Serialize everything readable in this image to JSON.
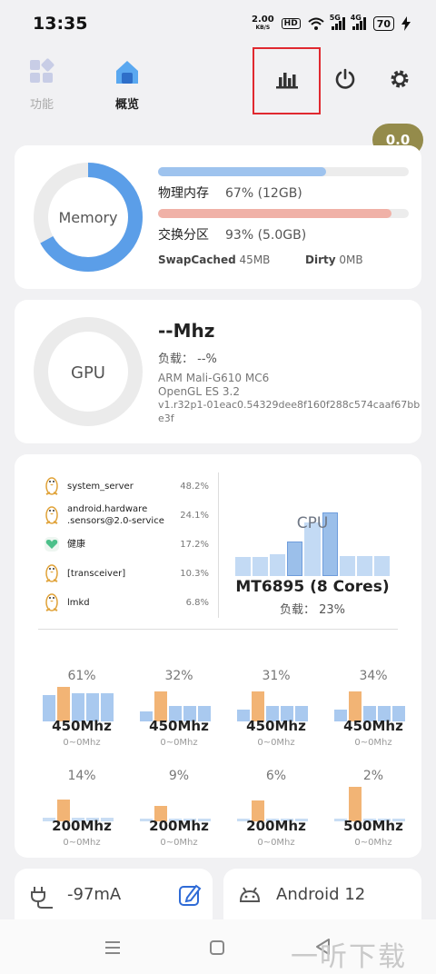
{
  "status": {
    "time": "13:35",
    "speed": "2.00",
    "speed_unit": "KB/S",
    "hd": "HD",
    "sig1": "5G",
    "sig2": "4G",
    "battery": "70"
  },
  "nav": {
    "features": "功能",
    "overview": "概览"
  },
  "badge": "0.0",
  "memory": {
    "ring_label": "Memory",
    "physical_label": "物理内存",
    "physical_value": "67% (12GB)",
    "physical_pct": 67,
    "swap_label": "交换分区",
    "swap_value": "93% (5.0GB)",
    "swap_pct": 93,
    "swapcached_label": "SwapCached",
    "swapcached_value": "45MB",
    "dirty_label": "Dirty",
    "dirty_value": "0MB",
    "colors": {
      "ring": "#5b9ee8",
      "physical": "#9ec3ee",
      "swap": "#f0b1a7"
    }
  },
  "gpu": {
    "ring_label": "GPU",
    "freq": "--Mhz",
    "load": "负载： --%",
    "model": "ARM Mali-G610 MC6",
    "api": "OpenGL ES 3.2",
    "driver_1": "v1.r32p1-01eac0.54329dee8f160f288c574caaf67bb",
    "driver_2": "e3f"
  },
  "processes": [
    {
      "name": "system_server",
      "value": "48.2%",
      "icon": "linux-penguin-icon"
    },
    {
      "name": "android.hardware",
      "name2": ".sensors@2.0-service",
      "value": "24.1%",
      "icon": "linux-penguin-icon"
    },
    {
      "name": "健康",
      "value": "17.2%",
      "icon": "health-heart-icon"
    },
    {
      "name": "[transceiver]",
      "value": "10.3%",
      "icon": "linux-penguin-icon"
    },
    {
      "name": "lmkd",
      "value": "6.8%",
      "icon": "linux-penguin-icon"
    }
  ],
  "cpu": {
    "label": "CPU",
    "model": "MT6895 (8 Cores)",
    "load": "负载： 23%",
    "overview_levels": [
      0.28,
      0.28,
      0.32,
      0.52,
      0.8,
      0.95,
      0.3,
      0.3,
      0.3
    ]
  },
  "cores": [
    {
      "pct": "61%",
      "freq": "450Mhz",
      "range": "0~0Mhz",
      "levels": [
        0.72,
        0.95,
        0.78,
        0.78,
        0.78
      ],
      "hi": 1
    },
    {
      "pct": "32%",
      "freq": "450Mhz",
      "range": "0~0Mhz",
      "levels": [
        0.28,
        0.82,
        0.42,
        0.42,
        0.42
      ],
      "hi": 1
    },
    {
      "pct": "31%",
      "freq": "450Mhz",
      "range": "0~0Mhz",
      "levels": [
        0.33,
        0.82,
        0.42,
        0.42,
        0.42
      ],
      "hi": 1
    },
    {
      "pct": "34%",
      "freq": "450Mhz",
      "range": "0~0Mhz",
      "levels": [
        0.33,
        0.82,
        0.42,
        0.42,
        0.42
      ],
      "hi": 1
    },
    {
      "pct": "14%",
      "freq": "200Mhz",
      "range": "0~0Mhz",
      "levels": [
        0.1,
        0.6,
        0.1,
        0.1,
        0.1
      ],
      "hi": 1
    },
    {
      "pct": "9%",
      "freq": "200Mhz",
      "range": "0~0Mhz",
      "levels": [
        0.05,
        0.42,
        0.05,
        0.05,
        0.05
      ],
      "hi": 1
    },
    {
      "pct": "6%",
      "freq": "200Mhz",
      "range": "0~0Mhz",
      "levels": [
        0.05,
        0.58,
        0.05,
        0.05,
        0.05
      ],
      "hi": 1
    },
    {
      "pct": "2%",
      "freq": "500Mhz",
      "range": "0~0Mhz",
      "levels": [
        0.05,
        0.95,
        0.05,
        0.05,
        0.05
      ],
      "hi": 1
    }
  ],
  "bottom": {
    "current": "-97mA",
    "android": "Android 12"
  },
  "watermark": "一听下载"
}
